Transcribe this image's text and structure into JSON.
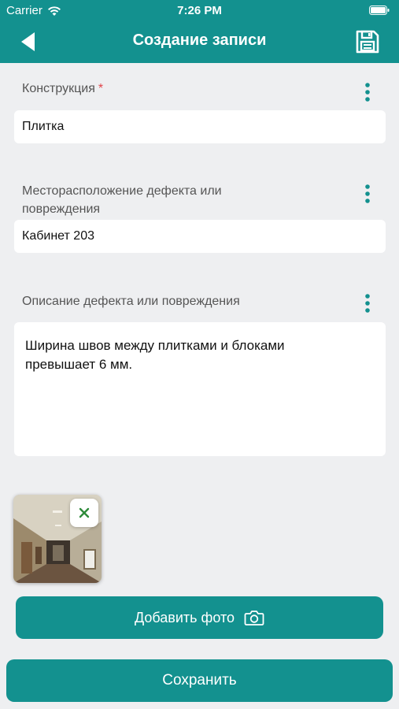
{
  "status_bar": {
    "carrier": "Carrier",
    "time": "7:26 PM"
  },
  "header": {
    "title": "Создание записи",
    "back_icon": "back-arrow-icon",
    "save_icon": "floppy-disk-icon"
  },
  "form": {
    "construction": {
      "label": "Конструкция",
      "required_mark": "*",
      "value": "Плитка"
    },
    "location": {
      "label_line1": "Месторасположение дефекта или",
      "label_line2": "повреждения",
      "value": "Кабинет 203"
    },
    "description": {
      "label": "Описание дефекта или повреждения",
      "value_line1": "Ширина швов между плитками и блоками",
      "value_line2": "превышает 6 мм."
    }
  },
  "photos": {
    "remove_icon": "close-icon"
  },
  "actions": {
    "add_photo_label": "Добавить фото",
    "add_photo_icon": "camera-icon",
    "save_label": "Сохранить"
  },
  "colors": {
    "accent": "#13918f",
    "background": "#eeeff1",
    "required": "#e0454b",
    "remove_x": "#2e8b3a"
  }
}
